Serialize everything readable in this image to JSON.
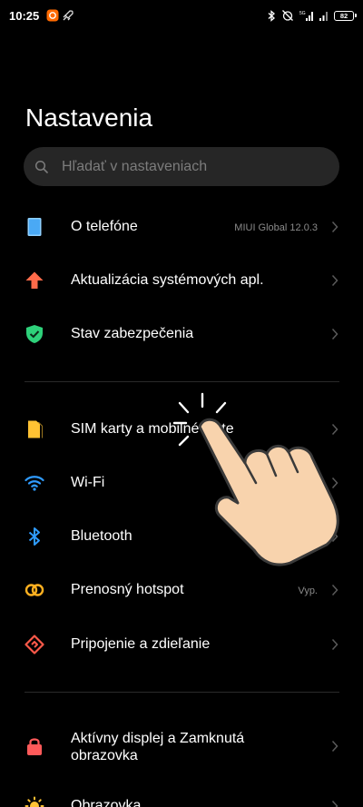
{
  "status_bar": {
    "time": "10:25",
    "battery": "82",
    "signal_label": "5G"
  },
  "header": {
    "title": "Nastavenia"
  },
  "search": {
    "placeholder": "Hľadať v nastaveniach"
  },
  "groups": [
    {
      "items": [
        {
          "label": "O telefóne",
          "value": "MIUI Global 12.0.3",
          "icon": "phone-icon",
          "color": "#6cb6ff"
        },
        {
          "label": "Aktualizácia systémových apl.",
          "value": "",
          "icon": "update-arrow-icon",
          "color": "#ff6b4a"
        },
        {
          "label": "Stav zabezpečenia",
          "value": "",
          "icon": "security-shield-icon",
          "color": "#2ed17a"
        }
      ]
    },
    {
      "items": [
        {
          "label": "SIM karty a mobilné siete",
          "value": "",
          "icon": "sim-card-icon",
          "color": "#ffc233"
        },
        {
          "label": "Wi-Fi",
          "value": "",
          "icon": "wifi-icon",
          "color": "#2f9bff"
        },
        {
          "label": "Bluetooth",
          "value": "",
          "icon": "bluetooth-icon",
          "color": "#2f9bff"
        },
        {
          "label": "Prenosný hotspot",
          "value": "Vyp.",
          "icon": "hotspot-icon",
          "color": "#ffb020"
        },
        {
          "label": "Pripojenie a zdieľanie",
          "value": "",
          "icon": "connection-sharing-icon",
          "color": "#ff5a4a"
        }
      ]
    },
    {
      "items": [
        {
          "label": "Aktívny displej a Zamknutá obrazovka",
          "value": "",
          "icon": "lock-icon",
          "color": "#ff5a5a"
        },
        {
          "label": "Obrazovka",
          "value": "",
          "icon": "brightness-icon",
          "color": "#ffc233"
        }
      ]
    }
  ]
}
